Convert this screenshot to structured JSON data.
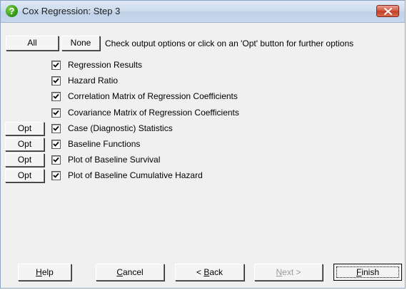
{
  "window": {
    "title": "Cox Regression: Step 3",
    "title_icon": "green-question-icon",
    "close_icon": "close-icon"
  },
  "toolbar": {
    "all_label": "All",
    "none_label": "None",
    "hint": "Check output options or click on an 'Opt' button for further options"
  },
  "options": [
    {
      "label": "Regression Results",
      "checked": true,
      "has_opt": false
    },
    {
      "label": "Hazard Ratio",
      "checked": true,
      "has_opt": false
    },
    {
      "label": "Correlation Matrix of Regression Coefficients",
      "checked": true,
      "has_opt": false
    },
    {
      "label": "Covariance Matrix of Regression Coefficients",
      "checked": true,
      "has_opt": false
    },
    {
      "label": "Case (Diagnostic) Statistics",
      "checked": true,
      "has_opt": true
    },
    {
      "label": "Baseline Functions",
      "checked": true,
      "has_opt": true
    },
    {
      "label": "Plot of Baseline Survival",
      "checked": true,
      "has_opt": true
    },
    {
      "label": "Plot of Baseline Cumulative Hazard",
      "checked": true,
      "has_opt": true
    }
  ],
  "opt_button_label": "Opt",
  "footer": {
    "help": {
      "accel": "H",
      "rest": "elp"
    },
    "cancel": {
      "accel": "C",
      "rest": "ancel"
    },
    "back": {
      "prefix": "< ",
      "accel": "B",
      "rest": "ack"
    },
    "next": {
      "accel": "N",
      "rest": "ext >",
      "enabled": false
    },
    "finish": {
      "accel": "F",
      "rest": "inish"
    }
  }
}
